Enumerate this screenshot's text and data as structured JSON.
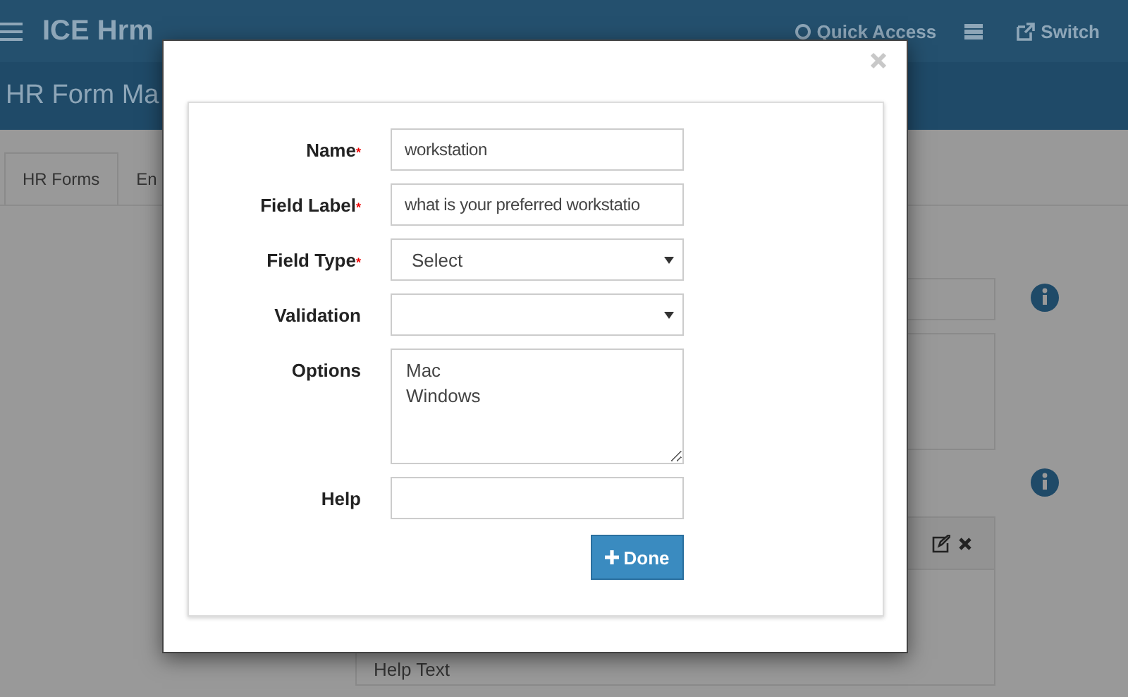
{
  "app": {
    "title": "ICE Hrm",
    "quick_access": "Quick Access",
    "switch": "Switch"
  },
  "page": {
    "title": "HR Form Ma"
  },
  "tabs": [
    {
      "label": "HR Forms",
      "selected": true
    },
    {
      "label": "En",
      "selected": false
    }
  ],
  "background_form": {
    "help_text": "Help Text"
  },
  "dialog": {
    "fields": [
      {
        "kind": "text",
        "label": "Name",
        "required": true,
        "value": "workstation"
      },
      {
        "kind": "text",
        "label": "Field Label",
        "required": true,
        "value": "what is your preferred workstatio"
      },
      {
        "kind": "select",
        "label": "Field Type",
        "required": true,
        "value": "Select"
      },
      {
        "kind": "select",
        "label": "Validation",
        "required": false
      },
      {
        "kind": "textarea",
        "label": "Options",
        "required": false,
        "value": "Mac\nWindows"
      },
      {
        "kind": "text",
        "label": "Help",
        "required": false
      }
    ],
    "required_mark": "*",
    "button": "Done"
  }
}
